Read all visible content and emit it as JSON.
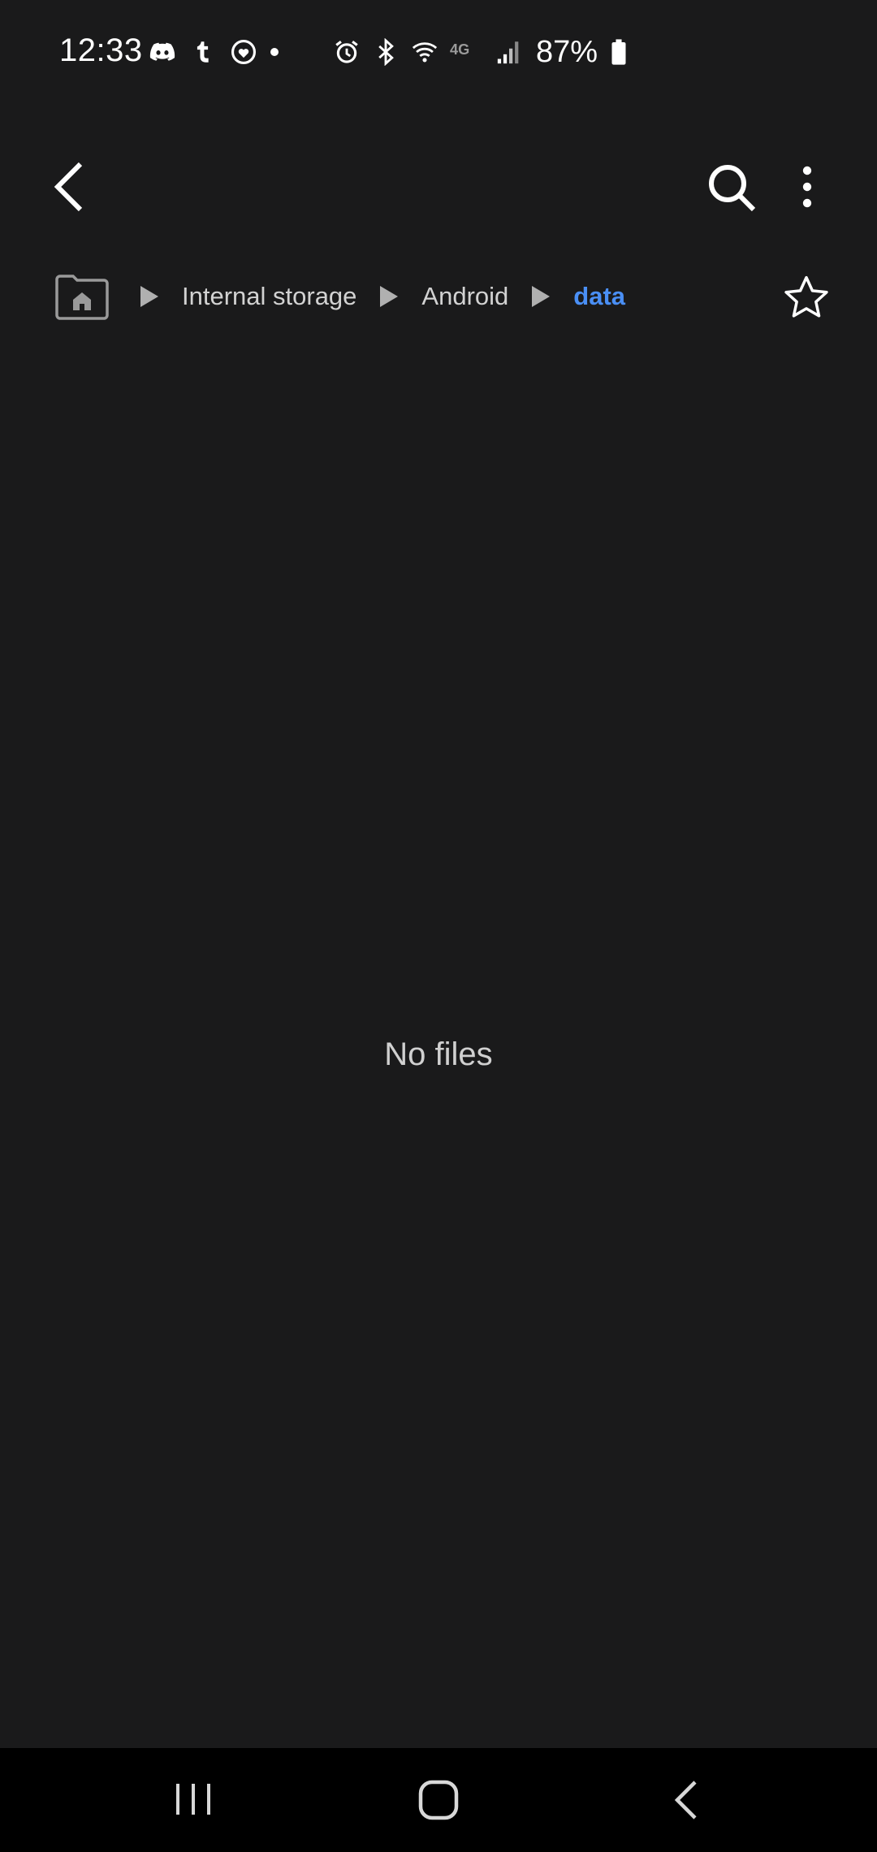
{
  "status_bar": {
    "time": "12:33",
    "battery_percent": "87%",
    "left_icons": [
      "discord-icon",
      "tumblr-icon",
      "heart-app-icon",
      "notification-dot"
    ],
    "right_icons": [
      "alarm-icon",
      "bluetooth-icon",
      "wifi-icon",
      "4g-icon",
      "signal-icon",
      "battery-icon"
    ],
    "network_type": "4G"
  },
  "app_bar": {
    "back_icon": "chevron-left-icon",
    "search_icon": "search-icon",
    "more_icon": "more-vertical-icon"
  },
  "breadcrumb": {
    "home_icon": "home-folder-icon",
    "items": [
      {
        "label": "Internal storage"
      },
      {
        "label": "Android"
      },
      {
        "label": "data"
      }
    ],
    "favorite_icon": "star-outline-icon"
  },
  "main": {
    "empty_message": "No files"
  },
  "nav_bar": {
    "recents_icon": "recents-icon",
    "home_icon": "home-icon",
    "back_icon": "back-icon"
  },
  "colors": {
    "background": "#1a1a1b",
    "nav_background": "#000000",
    "accent": "#4a8ff5",
    "text_primary": "#ffffff",
    "text_secondary": "#d2d2d2"
  }
}
